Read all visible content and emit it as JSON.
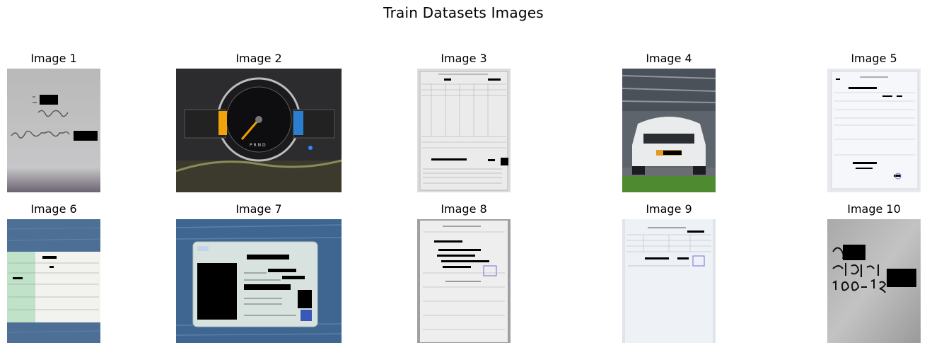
{
  "figure": {
    "title": "Train Datasets Images"
  },
  "images": [
    {
      "title": "Image 1",
      "content": "handwritten-note"
    },
    {
      "title": "Image 2",
      "content": "car-dashboard-odometer"
    },
    {
      "title": "Image 3",
      "content": "paper-document"
    },
    {
      "title": "Image 4",
      "content": "car-front-parking-garage"
    },
    {
      "title": "Image 5",
      "content": "paper-document"
    },
    {
      "title": "Image 6",
      "content": "paper-document-on-table"
    },
    {
      "title": "Image 7",
      "content": "drivers-license-card"
    },
    {
      "title": "Image 8",
      "content": "paper-document"
    },
    {
      "title": "Image 9",
      "content": "paper-document"
    },
    {
      "title": "Image 10",
      "content": "handwritten-note"
    }
  ]
}
